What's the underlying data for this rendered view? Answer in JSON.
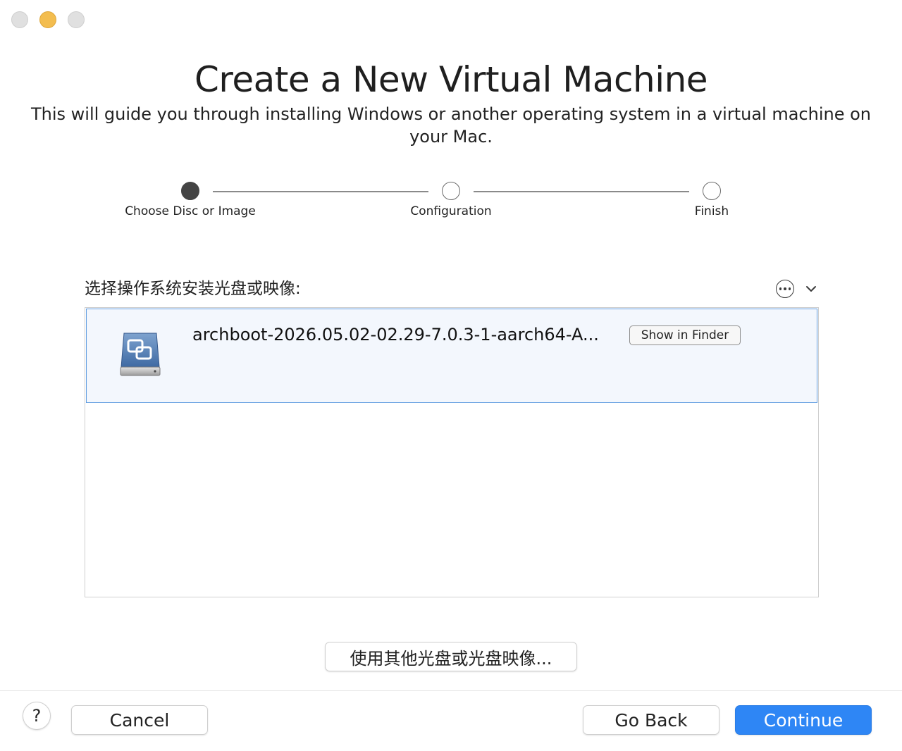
{
  "window": {
    "traffic_lights": [
      "close",
      "minimize",
      "zoom"
    ],
    "accent_color": "#2e86f5"
  },
  "header": {
    "title": "Create a New Virtual Machine",
    "subtitle": "This will guide you through installing Windows or another operating system in a virtual machine on your Mac."
  },
  "stepper": {
    "current_step": 1,
    "steps": [
      {
        "label": "Choose Disc or Image"
      },
      {
        "label": "Configuration"
      },
      {
        "label": "Finish"
      }
    ]
  },
  "selection": {
    "label": "选择操作系统安装光盘或映像:",
    "items": [
      {
        "name": "archboot-2026.05.02-02.29-7.0.3-1-aarch64-A...",
        "action": "Show in Finder",
        "selected": true,
        "icon": "disc-image-icon"
      }
    ]
  },
  "other_disc_button": "使用其他光盘或光盘映像...",
  "footer": {
    "help": "?",
    "cancel": "Cancel",
    "go_back": "Go Back",
    "continue": "Continue"
  }
}
